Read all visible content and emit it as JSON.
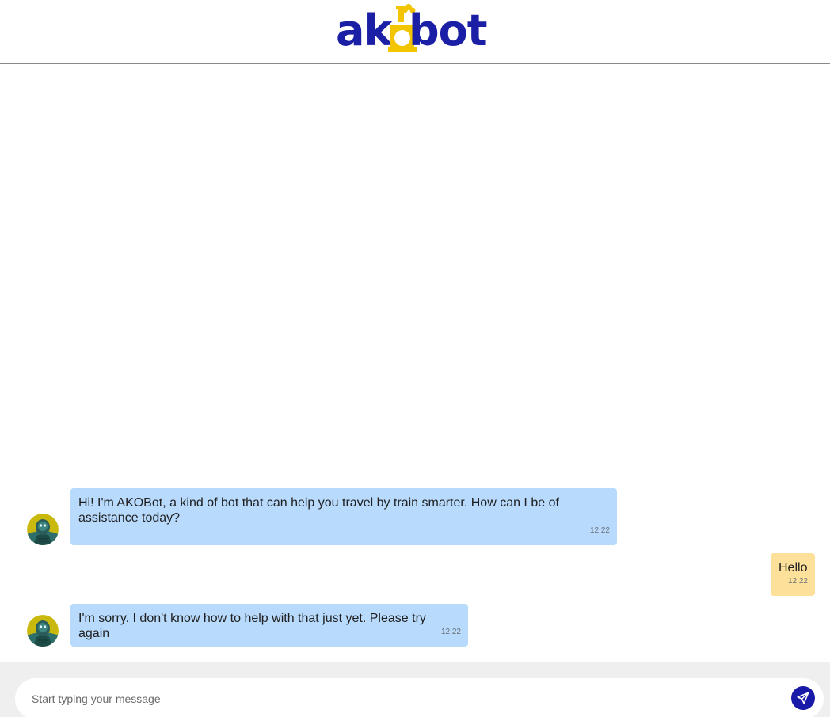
{
  "brand": {
    "logo_text_left": "ak",
    "logo_text_right": "bot",
    "logo_icon": "train-locomotive-icon",
    "primary_color": "#1b1fa6",
    "accent_color": "#f2c500"
  },
  "messages": [
    {
      "sender": "bot",
      "text": "Hi! I'm AKOBot, a kind of bot that can help you travel by train smarter. How can I be of assistance today?",
      "time": "12:22",
      "avatar_icon": "robot-avatar-icon",
      "bubble_color": "#b8dafc"
    },
    {
      "sender": "user",
      "text": "Hello",
      "time": "12:22",
      "bubble_color": "#fde09a"
    },
    {
      "sender": "bot",
      "text": "I'm sorry. I don't know how to help with that just yet. Please try again",
      "time": "12:22",
      "avatar_icon": "robot-avatar-icon",
      "bubble_color": "#b8dafc"
    }
  ],
  "composer": {
    "placeholder": "Start typing your message",
    "value": "",
    "send_icon": "paper-plane-icon"
  }
}
